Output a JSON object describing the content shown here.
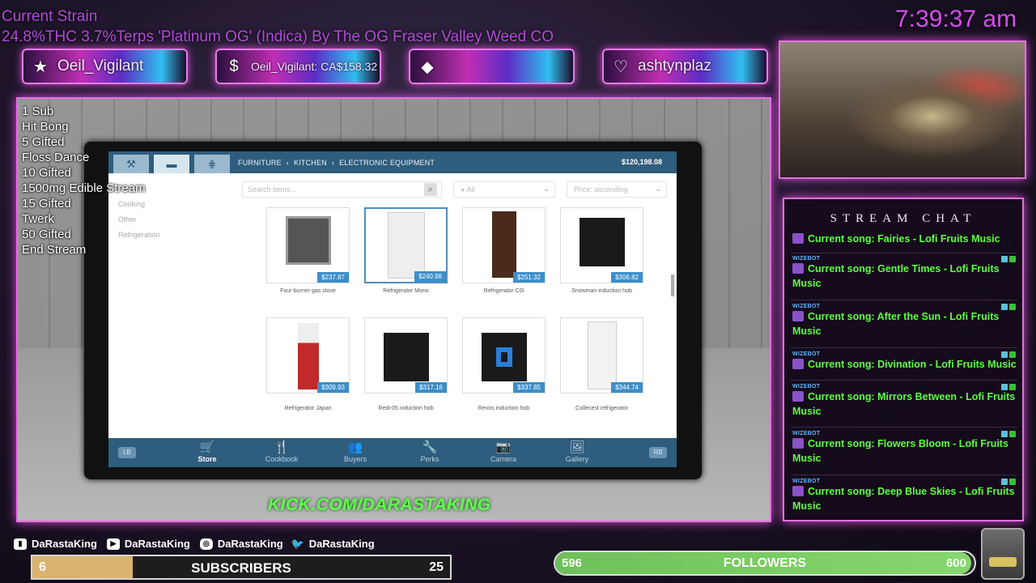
{
  "overlay": {
    "strain_title": "Current Strain",
    "strain_desc": "24.8%THC 3.7%Terps 'Platinum OG' (Indica) By The OG Fraser Valley Weed CO",
    "clock": "7:39:37 am",
    "accent_color": "#d74cf0"
  },
  "alerts": [
    {
      "icon": "star-icon",
      "text": "Oeil_Vigilant"
    },
    {
      "icon": "dollar-icon",
      "text": "Oeil_Vigilant: CA$158.32"
    },
    {
      "icon": "diamond-icon",
      "text": ""
    },
    {
      "icon": "heart-icon",
      "text": "ashtynplaz"
    }
  ],
  "goals": [
    "1 Sub",
    "Hit Bong",
    "5 Gifted",
    "Floss Dance",
    "10 Gifted",
    "1500mg Edible Stream",
    "15 Gifted",
    "Twerk",
    "50 Gifted",
    "End Stream"
  ],
  "game": {
    "breadcrumb": [
      "FURNITURE",
      "KITCHEN",
      "ELECTRONIC EQUIPMENT"
    ],
    "balance": "$120,198.08",
    "search_placeholder": "Search items...",
    "filter_value": "All",
    "sort_value": "Price: ascending",
    "categories": [
      "Cooking",
      "Other",
      "Refrigeration"
    ],
    "items": [
      {
        "name": "Four-burner gas stove",
        "price": "$237.87"
      },
      {
        "name": "Refrigerator Mono",
        "price": "$240.98"
      },
      {
        "name": "Refrigerator C0l",
        "price": "$251.32"
      },
      {
        "name": "Snowman induction hob",
        "price": "$306.82"
      },
      {
        "name": "Refrigerator Japan",
        "price": "$309.93"
      },
      {
        "name": "Redi-05 induction hob",
        "price": "$317.16"
      },
      {
        "name": "Revos induction hob",
        "price": "$337.85"
      },
      {
        "name": "Collecest refrigerator",
        "price": "$344.74"
      }
    ],
    "nav": {
      "lb": "LB",
      "rb": "RB",
      "items": [
        {
          "icon": "cart-icon",
          "label": "Store"
        },
        {
          "icon": "cutlery-icon",
          "label": "Cookbook"
        },
        {
          "icon": "people-icon",
          "label": "Buyers"
        },
        {
          "icon": "wrench-icon",
          "label": "Perks"
        },
        {
          "icon": "camera-icon",
          "label": "Camera"
        },
        {
          "icon": "picture-icon",
          "label": "Gallery"
        }
      ]
    }
  },
  "kick_url": "KICK.COM/DARASTAKING",
  "chat": {
    "title": "STREAM CHAT",
    "messages": [
      {
        "user": "",
        "text": "Current song: Fairies - Lofi Fruits Music"
      },
      {
        "user": "WIZEBOT",
        "text": "Current song: Gentle Times - Lofi Fruits Music"
      },
      {
        "user": "WIZEBOT",
        "text": "Current song: After the Sun - Lofi Fruits Music"
      },
      {
        "user": "WIZEBOT",
        "text": "Current song: Divination - Lofi Fruits Music"
      },
      {
        "user": "WIZEBOT",
        "text": "Current song: Mirrors Between - Lofi Fruits Music"
      },
      {
        "user": "WIZEBOT",
        "text": "Current song: Flowers Bloom - Lofi Fruits Music"
      },
      {
        "user": "WIZEBOT",
        "text": "Current song: Deep Blue Skies - Lofi Fruits Music"
      }
    ]
  },
  "socials": [
    {
      "icon": "twitch-icon",
      "handle": "DaRastaKing"
    },
    {
      "icon": "youtube-icon",
      "handle": "DaRastaKing"
    },
    {
      "icon": "instagram-icon",
      "handle": "DaRastaKing"
    },
    {
      "icon": "twitter-icon",
      "handle": "DaRastaKing"
    }
  ],
  "subscribers": {
    "current": "6",
    "label": "SUBSCRIBERS",
    "goal": "25",
    "progress": 0.24
  },
  "followers": {
    "current": "596",
    "label": "FOLLOWERS",
    "goal": "600",
    "progress": 0.993
  }
}
